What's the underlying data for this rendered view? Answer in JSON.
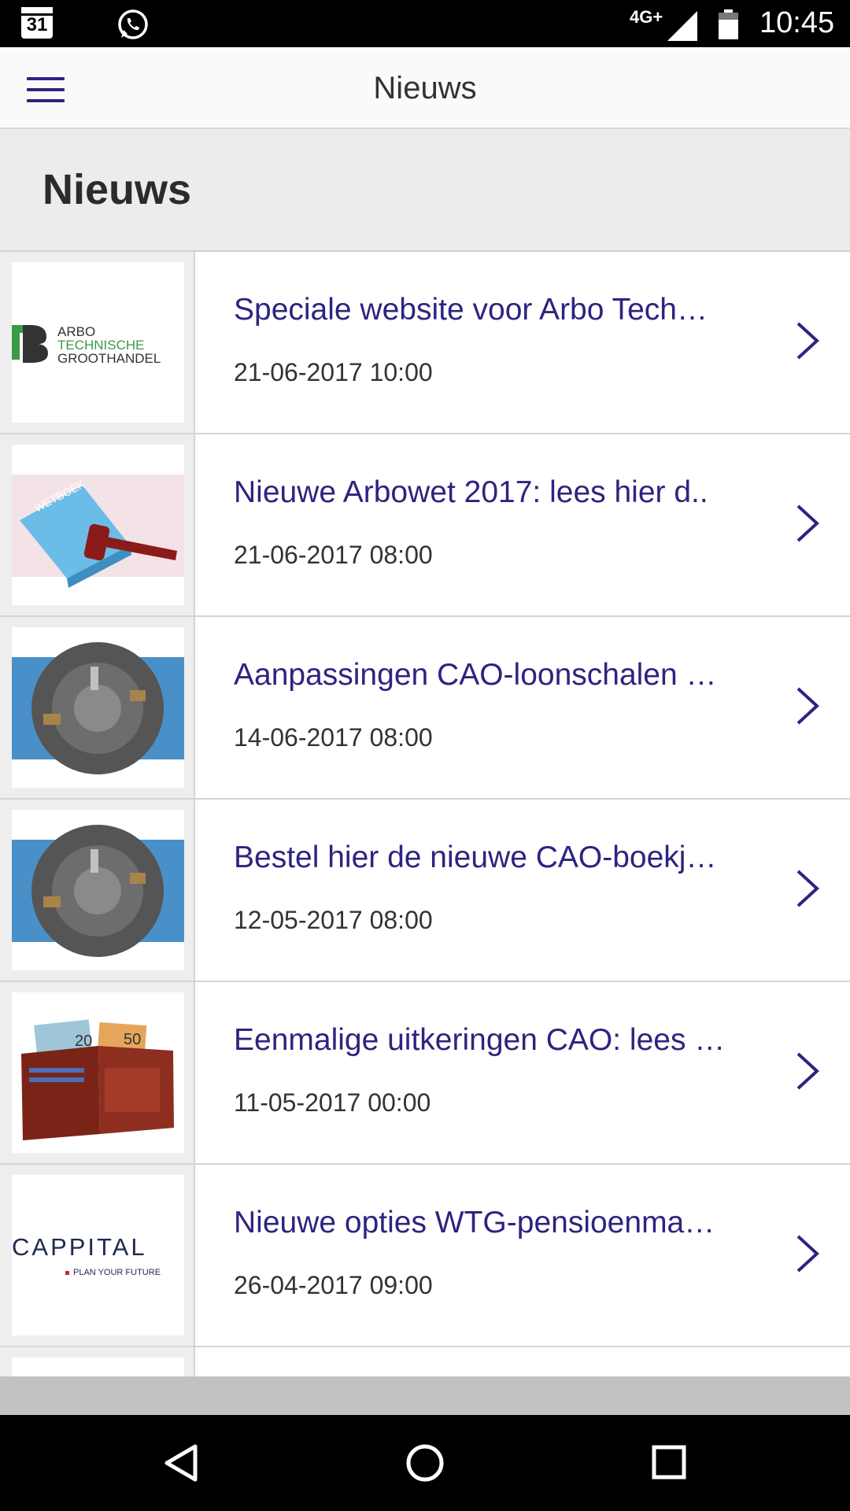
{
  "status_bar": {
    "calendar_day": "31",
    "network": "4G+",
    "time": "10:45"
  },
  "app_bar": {
    "title": "Nieuws",
    "menu_icon": "hamburger-menu-icon"
  },
  "page": {
    "heading": "Nieuws"
  },
  "news": {
    "items": [
      {
        "title": "Speciale website voor Arbo Tech…",
        "date": "21-06-2017 10:00",
        "thumb_text": [
          "ARBO",
          "TECHNISCHE",
          "GROOTHANDEL"
        ]
      },
      {
        "title": "Nieuwe Arbowet 2017: lees hier d..",
        "date": "21-06-2017 08:00",
        "thumb_text": [
          "WETBOEK"
        ]
      },
      {
        "title": "Aanpassingen CAO-loonschalen …",
        "date": "14-06-2017 08:00"
      },
      {
        "title": "Bestel hier de nieuwe CAO-boekj…",
        "date": "12-05-2017 08:00"
      },
      {
        "title": "Eenmalige uitkeringen CAO: lees …",
        "date": "11-05-2017 00:00",
        "thumb_text": [
          "20",
          "50"
        ]
      },
      {
        "title": "Nieuwe opties WTG-pensioenma…",
        "date": "26-04-2017 09:00",
        "thumb_text": [
          "CAPPITAL",
          "PLAN YOUR FUTURE"
        ]
      }
    ]
  },
  "colors": {
    "accent": "#2d2480",
    "header_bg": "#ececec",
    "appbar_bg": "#fafafa"
  }
}
